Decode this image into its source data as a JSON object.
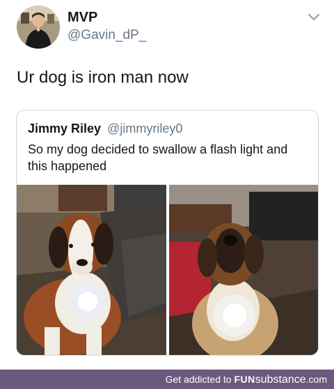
{
  "tweet": {
    "display_name": "MVP",
    "handle": "@Gavin_dP_",
    "text": "Ur dog is iron man now",
    "avatar_icon": "user-avatar-photo",
    "menu_icon": "chevron-down-icon"
  },
  "quoted_tweet": {
    "display_name": "Jimmy Riley",
    "handle": "@jimmyriley0",
    "text": "So my dog decided to swallow a flash light and this happened",
    "photos": [
      {
        "name": "dog-photo-left",
        "subject": "saint-bernard-glowing-chest"
      },
      {
        "name": "dog-photo-right",
        "subject": "saint-bernard-glowing-chest"
      }
    ]
  },
  "footer": {
    "tagline": "Get addicted to",
    "brand_fun": "FUN",
    "brand_sub": "substance",
    "brand_com": ".com",
    "background_color": "#6b5a7e"
  }
}
